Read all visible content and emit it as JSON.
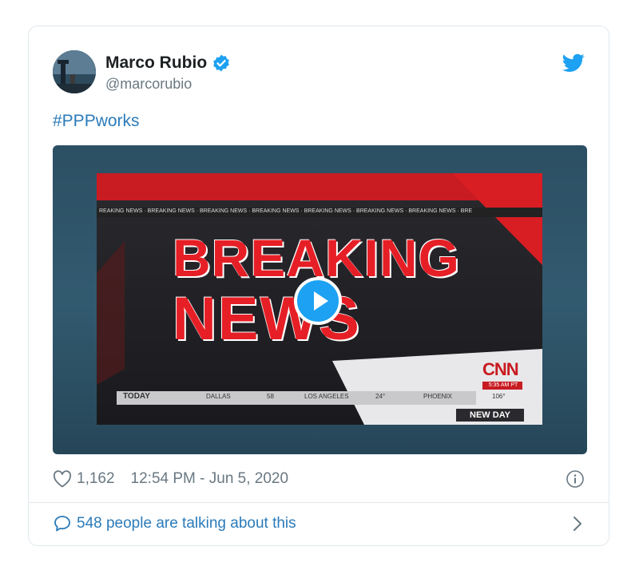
{
  "author": {
    "display_name": "Marco Rubio",
    "handle": "@marcorubio",
    "verified": true
  },
  "tweet": {
    "text": "#PPPworks"
  },
  "media": {
    "type": "video",
    "headline_line1": "BREAKING",
    "headline_line2": "NEWS",
    "ticker_text": "REAKING NEWS · BREAKING NEWS · BREAKING NEWS · BREAKING NEWS · BREAKING NEWS · BREAKING NEWS · BREAKING NEWS · BRE",
    "network_logo": "CNN",
    "clock": "5:35 AM PT",
    "show_name": "NEW DAY",
    "weather_bar": {
      "today": "TODAY",
      "cities": [
        {
          "name": "DALLAS",
          "temp": "58"
        },
        {
          "name": "LOS ANGELES",
          "temp": "24°"
        },
        {
          "name": "PHOENIX",
          "temp": "106°"
        }
      ]
    }
  },
  "footer": {
    "likes": "1,162",
    "timestamp": "12:54 PM - Jun 5, 2020",
    "talking": "548 people are talking about this"
  },
  "icons": {
    "verified": "verified-badge-icon",
    "twitter": "twitter-bird-icon",
    "heart": "heart-icon",
    "info": "info-icon",
    "bubble": "speech-bubble-icon",
    "chevron": "chevron-right-icon",
    "play": "play-icon"
  },
  "colors": {
    "brand_blue": "#1da1f2",
    "link_blue": "#2b7bb9",
    "muted_text": "#697882",
    "border": "#e1e8ed",
    "breaking_red": "#d81d23"
  }
}
